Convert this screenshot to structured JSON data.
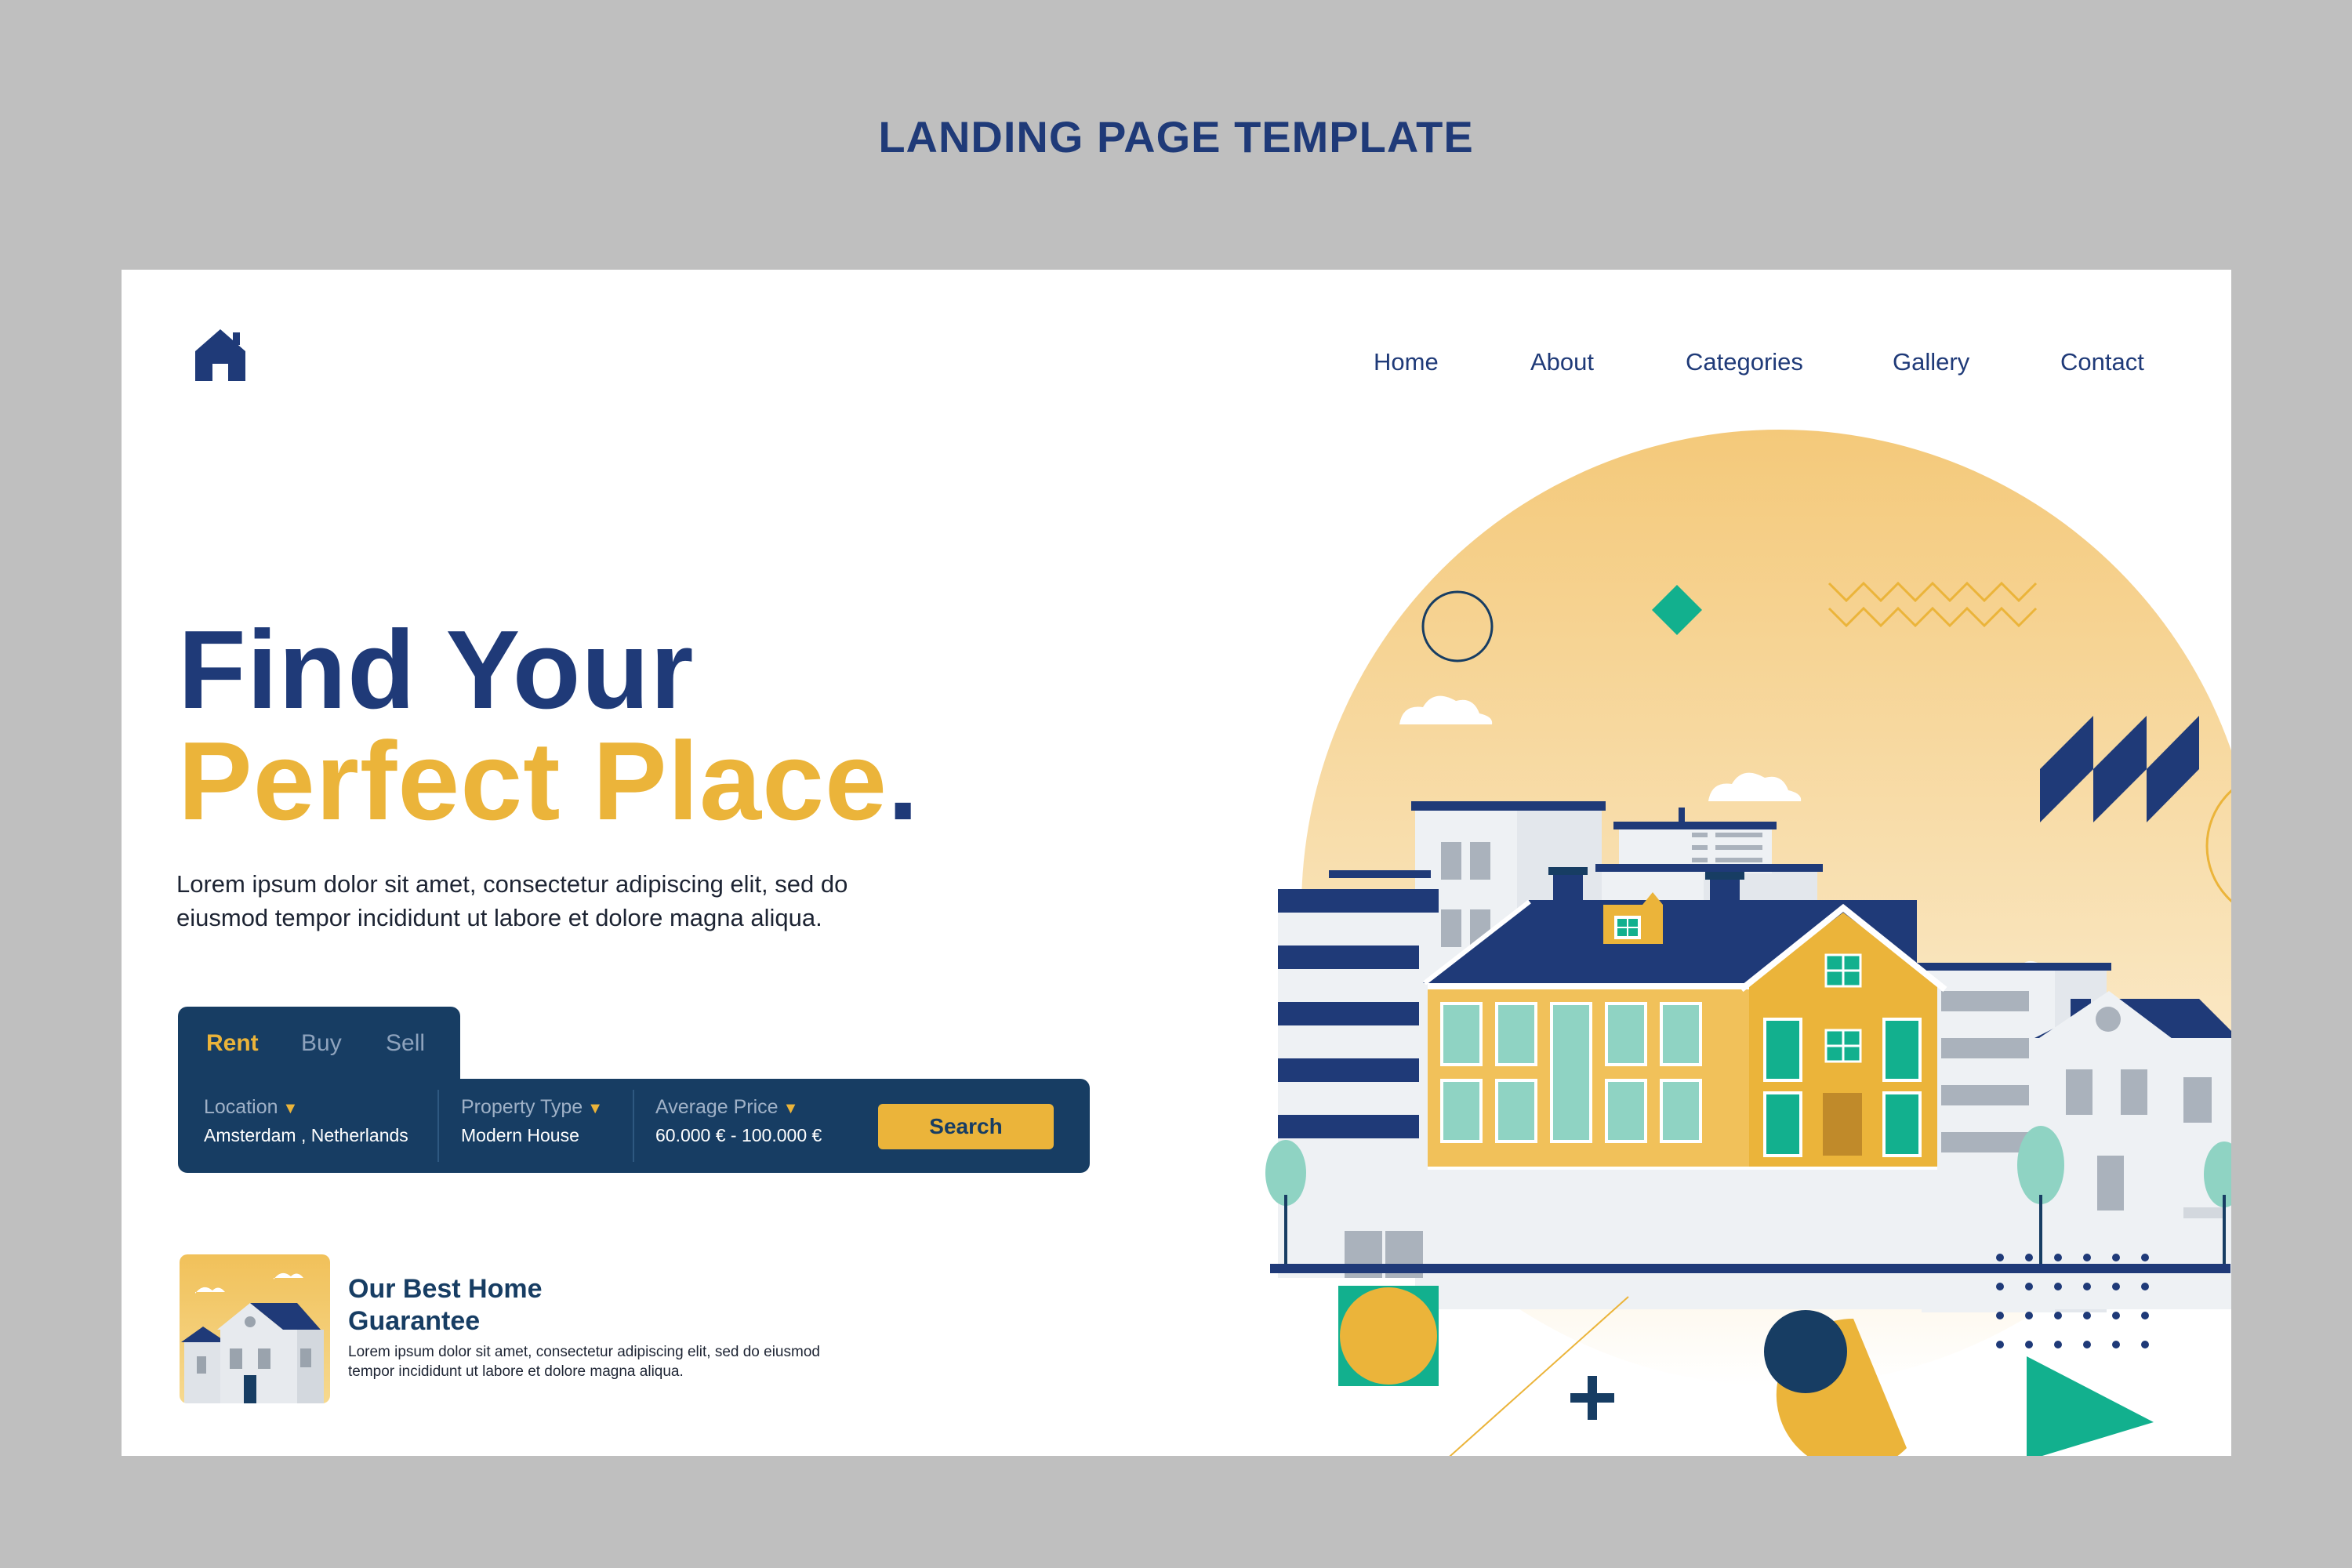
{
  "page": {
    "template_title": "LANDING PAGE TEMPLATE"
  },
  "nav": {
    "logo_icon": "house-icon",
    "items": [
      "Home",
      "About",
      "Categories",
      "Gallery",
      "Contact"
    ]
  },
  "hero": {
    "line1": "Find Your",
    "line2": "Perfect Place",
    "line2_end": ".",
    "description": "Lorem ipsum dolor sit amet, consectetur adipiscing elit, sed do eiusmod tempor incididunt ut labore et dolore magna aliqua."
  },
  "search": {
    "tabs": [
      "Rent",
      "Buy",
      "Sell"
    ],
    "active_tab": "Rent",
    "fields": [
      {
        "label": "Location",
        "value": "Amsterdam , Netherlands"
      },
      {
        "label": "Property Type",
        "value": "Modern House"
      },
      {
        "label": "Average Price",
        "value": "60.000 € - 100.000 €"
      }
    ],
    "button": "Search"
  },
  "guarantee": {
    "title": "Our Best Home Guarantee",
    "description": "Lorem ipsum dolor sit amet, consectetur adipiscing elit, sed do eiusmod tempor incididunt ut labore et dolore magna aliqua."
  },
  "colors": {
    "navy": "#1f3a78",
    "dark_navy": "#173d63",
    "yellow": "#ebb43a",
    "teal": "#12b08e",
    "background": "#bfbfbf"
  }
}
